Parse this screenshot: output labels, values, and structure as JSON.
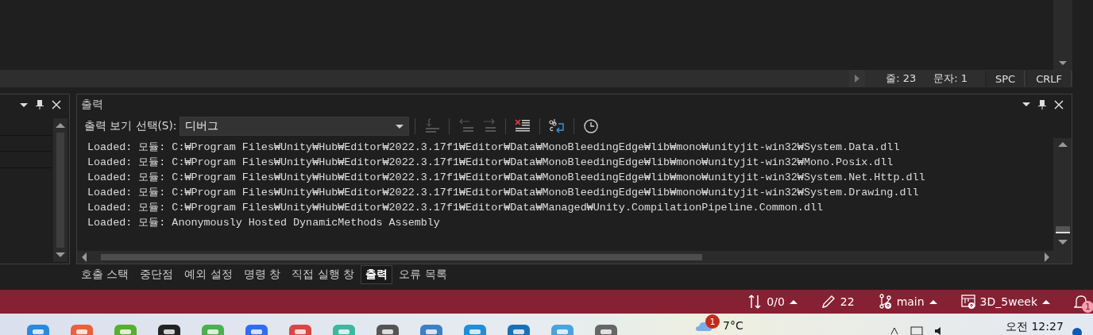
{
  "editor_status": {
    "line": "줄: 23",
    "column": "문자: 1",
    "indent": "SPC",
    "line_ending": "CRLF"
  },
  "output_panel": {
    "title": "출력",
    "source_label": "출력 보기 선택(S):",
    "source_value": "디버그",
    "toolbar": [
      {
        "kind": "goto",
        "disabled": true
      },
      {
        "kind": "prev",
        "disabled": true
      },
      {
        "kind": "next",
        "disabled": true
      },
      {
        "kind": "clear",
        "disabled": false
      },
      {
        "kind": "wrap",
        "disabled": false
      },
      {
        "kind": "clock",
        "disabled": false
      }
    ],
    "lines": [
      "Loaded: 모듈: C:₩Program Files₩Unity₩Hub₩Editor₩2022.3.17f1₩Editor₩Data₩MonoBleedingEdge₩lib₩mono₩unityjit-win32₩System.Data.dll",
      "Loaded: 모듈: C:₩Program Files₩Unity₩Hub₩Editor₩2022.3.17f1₩Editor₩Data₩MonoBleedingEdge₩lib₩mono₩unityjit-win32₩Mono.Posix.dll",
      "Loaded: 모듈: C:₩Program Files₩Unity₩Hub₩Editor₩2022.3.17f1₩Editor₩Data₩MonoBleedingEdge₩lib₩mono₩unityjit-win32₩System.Net.Http.dll",
      "Loaded: 모듈: C:₩Program Files₩Unity₩Hub₩Editor₩2022.3.17f1₩Editor₩Data₩MonoBleedingEdge₩lib₩mono₩unityjit-win32₩System.Drawing.dll",
      "Loaded: 모듈: C:₩Program Files₩Unity₩Hub₩Editor₩2022.3.17f1₩Editor₩Data₩Managed₩Unity.CompilationPipeline.Common.dll",
      "Loaded: 모듈: Anonymously Hosted DynamicMethods Assembly"
    ]
  },
  "bottom_tabs": [
    {
      "label": "호출 스택",
      "selected": false
    },
    {
      "label": "중단점",
      "selected": false
    },
    {
      "label": "예외 설정",
      "selected": false
    },
    {
      "label": "명령 창",
      "selected": false
    },
    {
      "label": "직접 실행 창",
      "selected": false
    },
    {
      "label": "출력",
      "selected": true
    },
    {
      "label": "오류 목록",
      "selected": false
    }
  ],
  "status_bar": {
    "sync": "0/0",
    "changes": "22",
    "branch": "main",
    "repo": "3D_5week",
    "notifications": "1"
  },
  "taskbar": {
    "weather_badge": "1",
    "temperature": "7°C",
    "time": "오전 12:27"
  }
}
